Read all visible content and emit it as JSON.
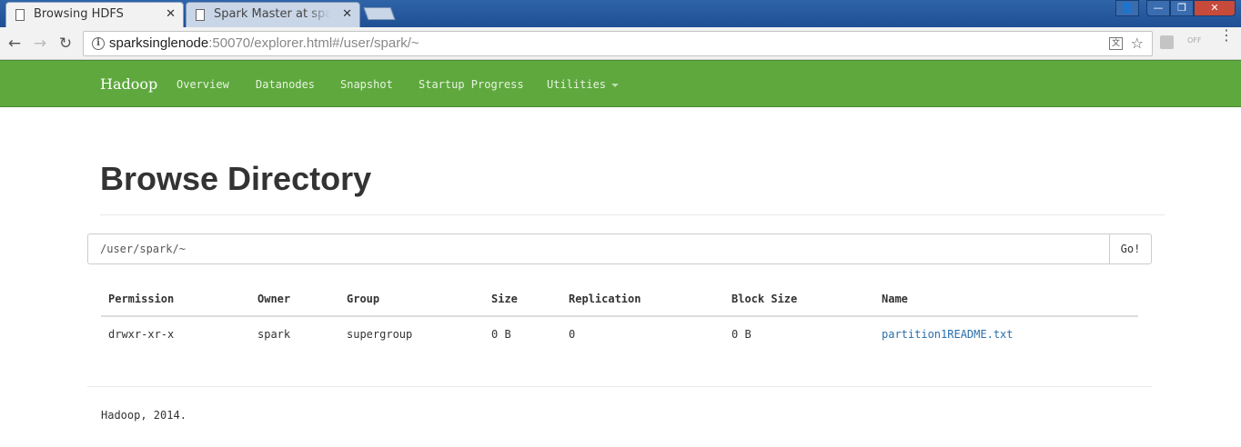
{
  "browser": {
    "tabs": [
      {
        "title": "Browsing HDFS",
        "close": "✕"
      },
      {
        "title": "Spark Master at spark",
        "close": "✕"
      }
    ],
    "url": {
      "host": "sparksinglenode",
      "rest": ":50070/explorer.html#/user/spark/~"
    },
    "icons": {
      "back": "←",
      "forward": "→",
      "reload": "↻",
      "star": "☆",
      "menu": "⋮",
      "info": "i",
      "translate": "文",
      "ext2": "OFF",
      "close": "✕",
      "min": "—",
      "max": "❐",
      "user": "👤"
    }
  },
  "navbar": {
    "brand": "Hadoop",
    "links": [
      "Overview",
      "Datanodes",
      "Snapshot",
      "Startup Progress",
      "Utilities"
    ]
  },
  "page": {
    "title": "Browse Directory",
    "path_value": "/user/spark/~",
    "go_label": "Go!"
  },
  "table": {
    "headers": [
      "Permission",
      "Owner",
      "Group",
      "Size",
      "Replication",
      "Block Size",
      "Name"
    ],
    "rows": [
      [
        "drwxr-xr-x",
        "spark",
        "supergroup",
        "0 B",
        "0",
        "0 B",
        "partition1README.txt"
      ]
    ]
  },
  "footer": {
    "text": "Hadoop, 2014."
  },
  "colors": {
    "navbar": "#5ea83e",
    "link": "#2a6fab"
  }
}
